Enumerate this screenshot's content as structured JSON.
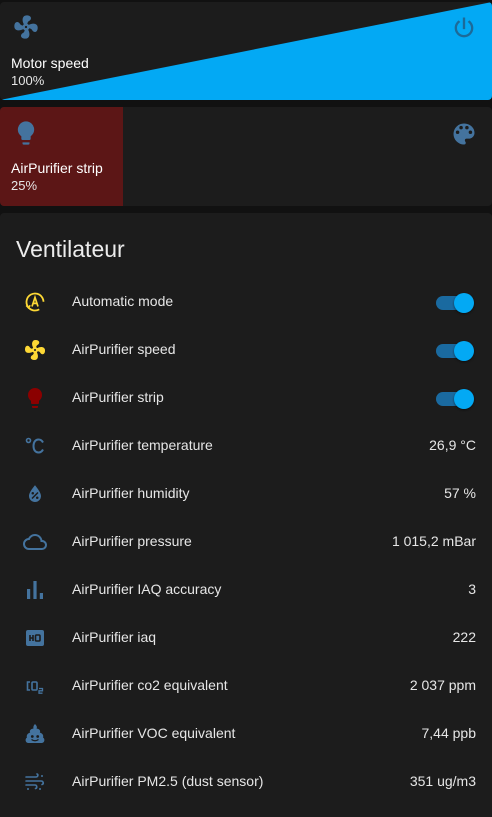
{
  "colors": {
    "accent": "#03a9f4",
    "icon_default": "#44739e",
    "icon_active_yellow": "#fdd835",
    "icon_strip_red": "#8b0000",
    "strip_fill": "#5c1616",
    "card_bg": "#1c1c1c",
    "page_bg": "#111111"
  },
  "motor_tile": {
    "name": "Motor speed",
    "state": "100%",
    "level": 1.0,
    "icon": "fan-icon",
    "action_icon": "power-icon"
  },
  "strip_tile": {
    "name": "AirPurifier strip",
    "state": "25%",
    "level": 0.25,
    "icon": "lightbulb-icon",
    "action_icon": "palette-icon"
  },
  "ventilateur": {
    "title": "Ventilateur",
    "rows": [
      {
        "icon": "auto-mode-icon",
        "label": "Automatic mode",
        "type": "toggle",
        "on": true
      },
      {
        "icon": "fan-icon",
        "label": "AirPurifier speed",
        "type": "toggle",
        "on": true
      },
      {
        "icon": "lightbulb-icon",
        "label": "AirPurifier strip",
        "type": "toggle",
        "on": true
      },
      {
        "icon": "thermometer-celsius-icon",
        "label": "AirPurifier temperature",
        "type": "value",
        "value": "26,9 °C"
      },
      {
        "icon": "water-percent-icon",
        "label": "AirPurifier humidity",
        "type": "value",
        "value": "57 %"
      },
      {
        "icon": "cloud-icon",
        "label": "AirPurifier pressure",
        "type": "value",
        "value": "1 015,2 mBar"
      },
      {
        "icon": "signal-bars-icon",
        "label": "AirPurifier IAQ accuracy",
        "type": "value",
        "value": "3"
      },
      {
        "icon": "hq-icon",
        "label": "AirPurifier iaq",
        "type": "value",
        "value": "222"
      },
      {
        "icon": "co2-icon",
        "label": "AirPurifier co2 equivalent",
        "type": "value",
        "value": "2 037 ppm"
      },
      {
        "icon": "emoticon-poop-icon",
        "label": "AirPurifier VOC equivalent",
        "type": "value",
        "value": "7,44 ppb"
      },
      {
        "icon": "weather-dust-icon",
        "label": "AirPurifier PM2.5 (dust sensor)",
        "type": "value",
        "value": "351 ug/m3"
      }
    ]
  }
}
